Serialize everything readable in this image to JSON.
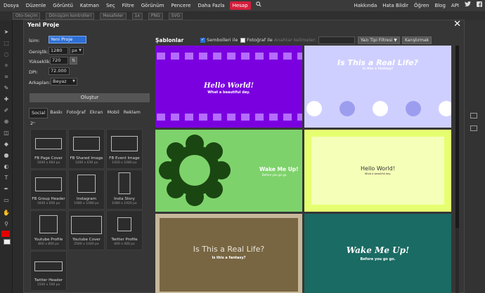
{
  "menu": {
    "items": [
      "Dosya",
      "Düzenle",
      "Görüntü",
      "Katman",
      "Seç",
      "Filtre",
      "Görünüm",
      "Pencere",
      "Daha Fazla"
    ],
    "active": "Hesap",
    "right_items": [
      "Hakkında",
      "Hata Bildir",
      "Öğren",
      "Blog",
      "API"
    ]
  },
  "optbar": {
    "items": [
      "Oto-Seçim",
      "Dönüşüm kontrolleri",
      "Mesafeler",
      "1x",
      "PNG",
      "SVG"
    ]
  },
  "modal": {
    "title": "Yeni Proje",
    "close": "✕",
    "form": {
      "name_label": "İsim:",
      "name_value": "Yeni Proje",
      "width_label": "Genişlik:",
      "width_value": "1280",
      "width_unit": "px",
      "height_label": "Yükseklik:",
      "height_value": "720",
      "dpi_label": "DPI:",
      "dpi_value": "72.000",
      "bg_label": "Arkaplan:",
      "bg_value": "Beyaz"
    },
    "create_label": "Oluştur",
    "tabs": [
      "Social",
      "Baskı",
      "Fotoğraf",
      "Ekran",
      "Mobil",
      "Reklam"
    ],
    "tabs_extra": "2ⁿ",
    "presets": [
      {
        "name": "FB Page Cover",
        "size": "1640 x 664 px"
      },
      {
        "name": "FB Shared Image",
        "size": "1200 x 630 px"
      },
      {
        "name": "FB Event Image",
        "size": "1920 x 1080 px"
      },
      {
        "name": "FB Group Header",
        "size": "1640 x 856 px"
      },
      {
        "name": "Instagram",
        "size": "1080 x 1080 px"
      },
      {
        "name": "Insta Story",
        "size": "1080 x 1920 px"
      },
      {
        "name": "Youtube Profile",
        "size": "800 x 800 px"
      },
      {
        "name": "Youtube Cover",
        "size": "2560 x 1440 px"
      },
      {
        "name": "Twitter Profile",
        "size": "400 x 400 px"
      },
      {
        "name": "Twitter Header",
        "size": "1500 x 500 px"
      }
    ],
    "templates_title": "Şablonlar",
    "symbols_label": "Sembolleri ile",
    "photo_label": "Fotoğraf ile",
    "keywords_placeholder": "Anahtar kelimeler:",
    "font_filter_label": "Yazı Tipi Filtresi ▼",
    "shuffle_label": "Karıştırmak",
    "templates": [
      {
        "title": "Hello World!",
        "subtitle": "What a beautiful day.",
        "bg": "#7a00e0"
      },
      {
        "title": "Is This a Real Life?",
        "subtitle": "Is this a fantasy?",
        "bg": "#cfcfff"
      },
      {
        "title": "Wake Me Up!",
        "subtitle": "Before you go go.",
        "bg": "#7ed26b"
      },
      {
        "title": "Hello World!",
        "subtitle": "What a beautiful day.",
        "bg": "#e6ff70"
      },
      {
        "title": "Is This a Real Life?",
        "subtitle": "Is this a fantasy?",
        "bg": "#786642"
      },
      {
        "title": "Wake Me Up!",
        "subtitle": "Before you go go.",
        "bg": "#1a6b63"
      }
    ]
  }
}
